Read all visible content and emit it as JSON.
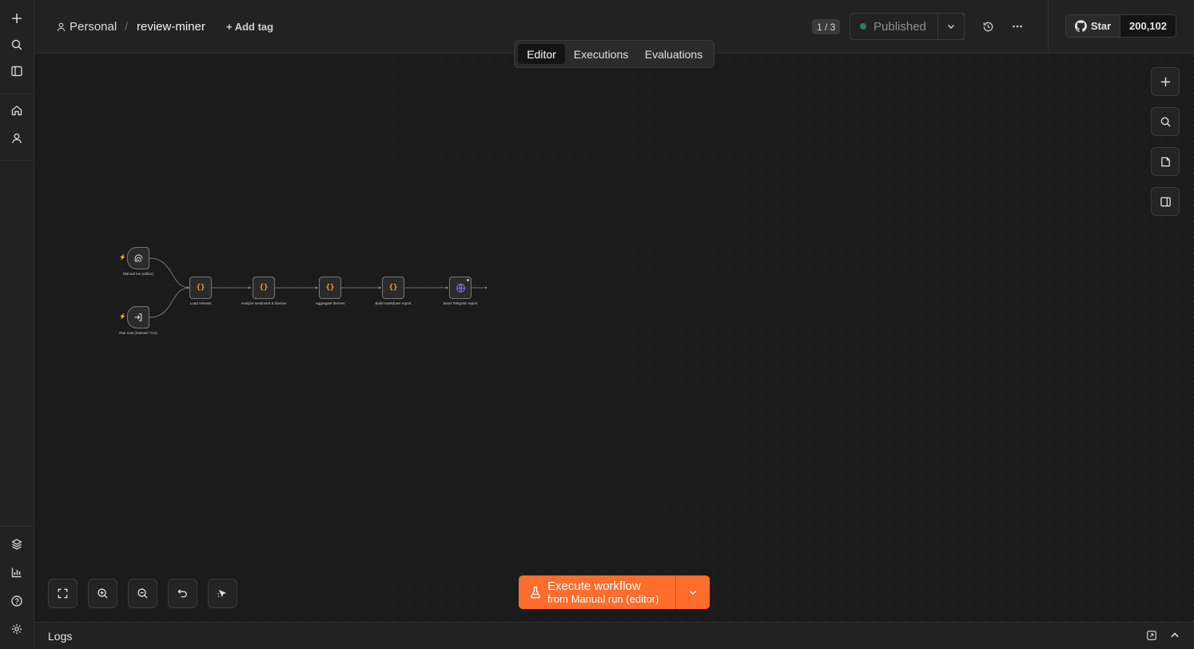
{
  "header": {
    "project": "Personal",
    "separator": "/",
    "workflow_name": "review-miner",
    "add_tag": "+ Add tag",
    "version_count": "1 / 3",
    "status": "Published",
    "github": {
      "star_label": "Star",
      "star_count": "200,102"
    }
  },
  "tabs": [
    {
      "label": "Editor",
      "active": true
    },
    {
      "label": "Executions",
      "active": false
    },
    {
      "label": "Evaluations",
      "active": false
    }
  ],
  "nodes": [
    {
      "label": "Manual run (editor)",
      "icon": "fingerprint-icon",
      "type": "trigger"
    },
    {
      "label": "Run now (manual / CLI)",
      "icon": "sign-in-icon",
      "type": "trigger"
    },
    {
      "label": "Load reviews",
      "icon": "code-braces-icon",
      "glyph": "{}"
    },
    {
      "label": "Analyze sentiment & themes",
      "icon": "code-braces-icon",
      "glyph": "{}"
    },
    {
      "label": "Aggregate themes",
      "icon": "code-braces-icon",
      "glyph": "{}"
    },
    {
      "label": "Build markdown report",
      "icon": "code-braces-icon",
      "glyph": "{}"
    },
    {
      "label": "Send Telegram report",
      "icon": "globe-icon"
    }
  ],
  "trigger_marker": "⚡",
  "execute": {
    "title": "Execute workflow",
    "from_prefix": "from",
    "from_node": "Manual run (editor)"
  },
  "logs": {
    "label": "Logs"
  },
  "colors": {
    "accent": "#ff6d2d",
    "node_code": "#ff9d3c",
    "globe": "#7b7bff",
    "status_dot": "#2f7d5c"
  }
}
